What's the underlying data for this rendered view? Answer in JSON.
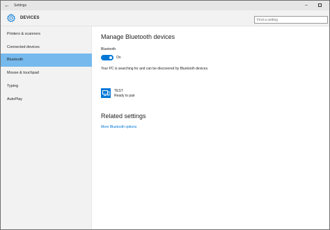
{
  "window": {
    "title": "Settings",
    "back_glyph": "←",
    "minimize_glyph": "–"
  },
  "header": {
    "icon": "gear-icon",
    "section_title": "DEVICES",
    "search_placeholder": "Find a setting"
  },
  "sidebar": {
    "items": [
      {
        "label": "Printers & scanners",
        "active": false
      },
      {
        "label": "Connected devices",
        "active": false
      },
      {
        "label": "Bluetooth",
        "active": true
      },
      {
        "label": "Mouse & touchpad",
        "active": false
      },
      {
        "label": "Typing",
        "active": false
      },
      {
        "label": "AutoPlay",
        "active": false
      }
    ]
  },
  "main": {
    "title": "Manage Bluetooth devices",
    "bluetooth_label": "Bluetooth",
    "toggle_state": "On",
    "toggle_on": true,
    "searching_text": "Your PC is searching for and can be discovered by Bluetooth devices.",
    "devices": [
      {
        "name": "TEST",
        "status": "Ready to pair",
        "icon": "computer-icon"
      }
    ],
    "related_title": "Related settings",
    "more_link": "More Bluetooth options"
  },
  "colors": {
    "accent": "#0078d7",
    "selected_nav": "#76b9ed",
    "sidebar_bg": "#f2f2f2",
    "titlebar_bg": "#e6e6e6"
  }
}
